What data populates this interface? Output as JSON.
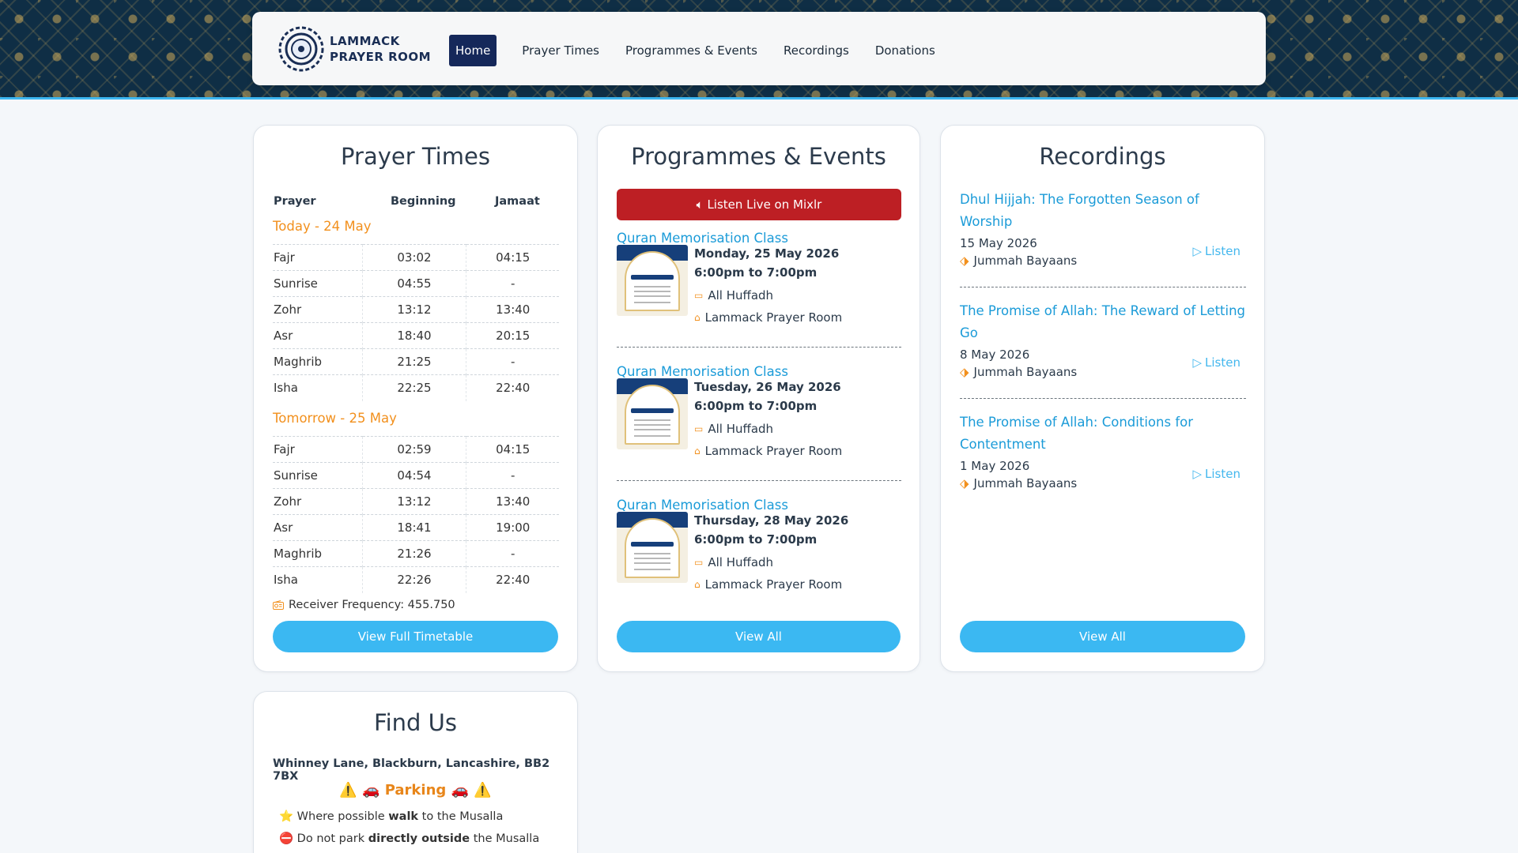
{
  "header": {
    "logo_line1": "LAMMACK",
    "logo_line2": "PRAYER ROOM",
    "nav": [
      {
        "label": "Home",
        "active": true
      },
      {
        "label": "Prayer Times"
      },
      {
        "label": "Programmes & Events"
      },
      {
        "label": "Recordings"
      },
      {
        "label": "Donations"
      }
    ]
  },
  "prayer_times": {
    "title": "Prayer Times",
    "columns": [
      "Prayer",
      "Beginning",
      "Jamaat"
    ],
    "today_label": "Today - 24 May",
    "today": [
      [
        "Fajr",
        "03:02",
        "04:15"
      ],
      [
        "Sunrise",
        "04:55",
        "-"
      ],
      [
        "Zohr",
        "13:12",
        "13:40"
      ],
      [
        "Asr",
        "18:40",
        "20:15"
      ],
      [
        "Maghrib",
        "21:25",
        "-"
      ],
      [
        "Isha",
        "22:25",
        "22:40"
      ]
    ],
    "tomorrow_label": "Tomorrow - 25 May",
    "tomorrow": [
      [
        "Fajr",
        "02:59",
        "04:15"
      ],
      [
        "Sunrise",
        "04:54",
        "-"
      ],
      [
        "Zohr",
        "13:12",
        "13:40"
      ],
      [
        "Asr",
        "18:41",
        "19:00"
      ],
      [
        "Maghrib",
        "21:26",
        "-"
      ],
      [
        "Isha",
        "22:26",
        "22:40"
      ]
    ],
    "receiver": "Receiver Frequency: 455.750",
    "button": "View Full Timetable"
  },
  "events": {
    "title": "Programmes & Events",
    "live_button": "Listen Live on Mixlr",
    "items": [
      {
        "title": "Quran Memorisation Class",
        "date": "Monday, 25 May 2026",
        "time": "6:00pm to 7:00pm",
        "audience": "All Huffadh",
        "location": "Lammack Prayer Room"
      },
      {
        "title": "Quran Memorisation Class",
        "date": "Tuesday, 26 May 2026",
        "time": "6:00pm to 7:00pm",
        "audience": "All Huffadh",
        "location": "Lammack Prayer Room"
      },
      {
        "title": "Quran Memorisation Class",
        "date": "Thursday, 28 May 2026",
        "time": "6:00pm to 7:00pm",
        "audience": "All Huffadh",
        "location": "Lammack Prayer Room"
      }
    ],
    "button": "View All"
  },
  "recordings": {
    "title": "Recordings",
    "items": [
      {
        "title": "Dhul Hijjah: The Forgotten Season of Worship",
        "date": "15 May 2026",
        "tag": "Jummah Bayaans",
        "listen": "Listen"
      },
      {
        "title": "The Promise of Allah: The Reward of Letting Go",
        "date": "8 May 2026",
        "tag": "Jummah Bayaans",
        "listen": "Listen"
      },
      {
        "title": "The Promise of Allah: Conditions for Contentment",
        "date": "1 May 2026",
        "tag": "Jummah Bayaans",
        "listen": "Listen"
      }
    ],
    "button": "View All"
  },
  "find_us": {
    "title": "Find Us",
    "address": "Whinney Lane, Blackburn, Lancashire, BB2 7BX",
    "parking_title": "⚠️ 🚗 Parking 🚗 ⚠️",
    "tip1_pre": "Where possible ",
    "tip1_bold": "walk",
    "tip1_post": " to the Musalla",
    "tip2_pre": "Do not park ",
    "tip2_bold": "directly outside",
    "tip2_post": " the Musalla",
    "tip1_icon": "⭐",
    "tip2_icon": "⛔"
  }
}
